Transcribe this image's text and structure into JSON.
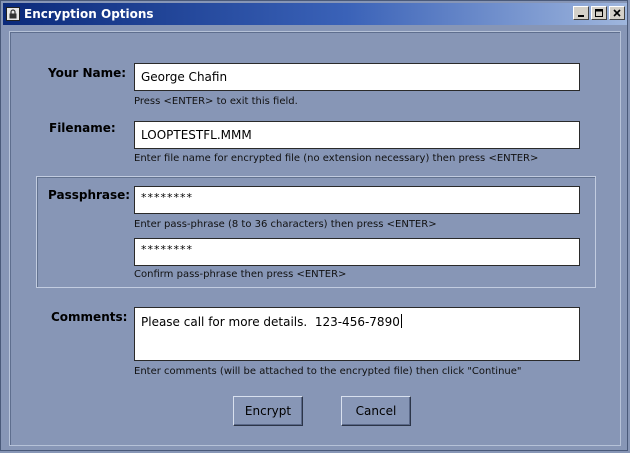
{
  "window": {
    "title": "Encryption Options",
    "icon": "lock-icon",
    "controls": [
      "minimize-icon",
      "maximize-icon",
      "close-icon"
    ]
  },
  "name": {
    "label": "Your Name:",
    "value": "George Chafin",
    "hint": "Press <ENTER> to exit this field."
  },
  "filename": {
    "label": "Filename:",
    "value": "LOOPTESTFL.MMM",
    "hint": "Enter file name for encrypted file (no extension necessary) then press <ENTER>"
  },
  "passphrase": {
    "label": "Passphrase:",
    "value": "********",
    "hint": "Enter pass-phrase (8 to 36 characters) then press <ENTER>",
    "confirm_value": "********",
    "confirm_hint": "Confirm pass-phrase then press <ENTER>"
  },
  "comments": {
    "label": "Comments:",
    "value": "Please call for more details.  123-456-7890",
    "hint": "Enter comments (will be attached to the encrypted file) then click \"Continue\""
  },
  "buttons": {
    "encrypt": "Encrypt",
    "cancel": "Cancel"
  },
  "colors": {
    "background": "#8796b6",
    "titlebar_start": "#0b2a7a",
    "titlebar_end": "#9fb6dd"
  }
}
